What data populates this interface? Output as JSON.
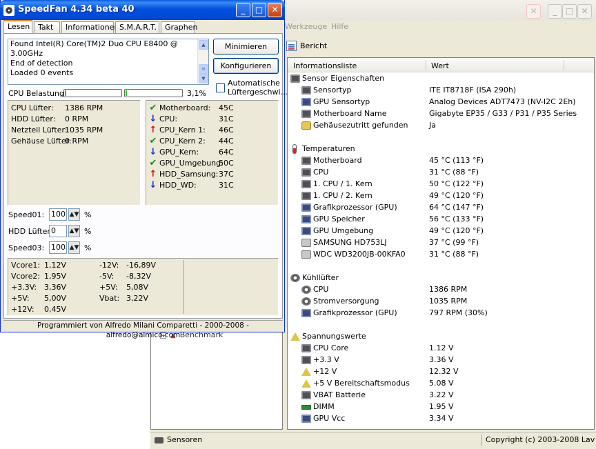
{
  "background_app": {
    "menu": [
      "Werkzeuge",
      "Hilfe"
    ],
    "toolbar_report": "Bericht",
    "left_tree_item": "Benchmark",
    "columns": {
      "name": "Informationsliste",
      "value": "Wert"
    },
    "groups": [
      {
        "title": "Sensor Eigenschaften",
        "icon": "chip-icon",
        "items": [
          {
            "label": "Sensortyp",
            "value": "ITE IT8718F (ISA 290h)",
            "icon": "chip-icon"
          },
          {
            "label": "GPU Sensortyp",
            "value": "Analog Devices ADT7473 (NV-I2C 2Eh)",
            "icon": "gpu-chip-icon"
          },
          {
            "label": "Motherboard Name",
            "value": "Gigabyte EP35 / G33 / P31 / P35 Series",
            "icon": "chip-icon"
          },
          {
            "label": "Gehäusezutritt gefunden",
            "value": "Ja",
            "icon": "lock-icon"
          }
        ]
      },
      {
        "title": "Temperaturen",
        "icon": "thermometer-icon",
        "items": [
          {
            "label": "Motherboard",
            "value": "45 °C  (113 °F)",
            "icon": "chip-icon"
          },
          {
            "label": "CPU",
            "value": "31 °C  (88 °F)",
            "icon": "chip-icon"
          },
          {
            "label": "1. CPU / 1. Kern",
            "value": "50 °C  (122 °F)",
            "icon": "chip-icon"
          },
          {
            "label": "1. CPU / 2. Kern",
            "value": "49 °C  (120 °F)",
            "icon": "chip-icon"
          },
          {
            "label": "Grafikprozessor (GPU)",
            "value": "64 °C  (147 °F)",
            "icon": "gpu-chip-icon"
          },
          {
            "label": "GPU Speicher",
            "value": "56 °C  (133 °F)",
            "icon": "gpu-chip-icon"
          },
          {
            "label": "GPU Umgebung",
            "value": "49 °C  (120 °F)",
            "icon": "gpu-chip-icon"
          },
          {
            "label": "SAMSUNG HD753LJ",
            "value": "37 °C  (99 °F)",
            "icon": "disk-icon"
          },
          {
            "label": "WDC WD3200JB-00KFA0",
            "value": "31 °C  (88 °F)",
            "icon": "disk-icon"
          }
        ]
      },
      {
        "title": "Kühllüfter",
        "icon": "fan-icon",
        "items": [
          {
            "label": "CPU",
            "value": "1386 RPM",
            "icon": "fan-icon"
          },
          {
            "label": "Stromversorgung",
            "value": "1035 RPM",
            "icon": "fan-icon"
          },
          {
            "label": "Grafikprozessor (GPU)",
            "value": "797 RPM  (30%)",
            "icon": "gpu-chip-icon"
          }
        ]
      },
      {
        "title": "Spannungswerte",
        "icon": "voltage-icon",
        "items": [
          {
            "label": "CPU Core",
            "value": "1.12 V",
            "icon": "chip-icon"
          },
          {
            "label": "+3.3 V",
            "value": "3.36 V",
            "icon": "chip-icon"
          },
          {
            "label": "+12 V",
            "value": "12.32 V",
            "icon": "voltage-icon"
          },
          {
            "label": "+5 V Bereitschaftsmodus",
            "value": "5.08 V",
            "icon": "voltage-icon"
          },
          {
            "label": "VBAT Batterie",
            "value": "3.22 V",
            "icon": "chip-icon"
          },
          {
            "label": "DIMM",
            "value": "1.95 V",
            "icon": "dimm-icon"
          },
          {
            "label": "GPU Vcc",
            "value": "3.34 V",
            "icon": "gpu-chip-icon"
          }
        ]
      }
    ],
    "status_left": "Sensoren",
    "status_right": "Copyright (c) 2003-2008 Lav"
  },
  "speedfan": {
    "title": "SpeedFan 4.34 beta 40",
    "tabs": [
      "Lesen",
      "Takt",
      "Informationen",
      "S.M.A.R.T.",
      "Graphen"
    ],
    "log": [
      "Found Intel(R) Core(TM)2 Duo CPU E8400 @ 3.00GHz",
      "End of detection",
      "Loaded 0 events"
    ],
    "buttons": {
      "minimize": "Minimieren",
      "configure": "Konfigurieren"
    },
    "auto_fan_label": "Automatische Lüftergeschwi...",
    "cpu_load_label": "CPU Belastung",
    "cpu_load_value": "3,1%",
    "cpu_core_usage": [
      0.03,
      0.02
    ],
    "fans": [
      {
        "label": "CPU Lüfter:",
        "value": "1386 RPM"
      },
      {
        "label": "HDD Lüfter:",
        "value": "0 RPM"
      },
      {
        "label": "Netzteil Lüfter:",
        "value": "1035 RPM"
      },
      {
        "label": "Gehäuse Lüfter:",
        "value": "0 RPM"
      }
    ],
    "temps": [
      {
        "label": "Motherboard:",
        "value": "45C",
        "state": "ok"
      },
      {
        "label": "CPU:",
        "value": "31C",
        "state": "down"
      },
      {
        "label": "CPU_Kern 1:",
        "value": "46C",
        "state": "up"
      },
      {
        "label": "CPU_Kern 2:",
        "value": "44C",
        "state": "ok"
      },
      {
        "label": "GPU_Kern:",
        "value": "64C",
        "state": "down"
      },
      {
        "label": "GPU_Umgebung:",
        "value": "50C",
        "state": "ok"
      },
      {
        "label": "HDD_Samsung:",
        "value": "37C",
        "state": "up"
      },
      {
        "label": "HDD_WD:",
        "value": "31C",
        "state": "down"
      }
    ],
    "speeds": [
      {
        "label": "Speed01:",
        "value": "100"
      },
      {
        "label": "HDD Lüfter:",
        "value": "0"
      },
      {
        "label": "Speed03:",
        "value": "100"
      }
    ],
    "percent_sign": "%",
    "voltages_left": [
      {
        "label": "Vcore1:",
        "value": "1,12V"
      },
      {
        "label": "Vcore2:",
        "value": "1,95V"
      },
      {
        "label": "+3.3V:",
        "value": "3,36V"
      },
      {
        "label": "+5V:",
        "value": "5,00V"
      },
      {
        "label": "+12V:",
        "value": "0,45V"
      }
    ],
    "voltages_right": [
      {
        "label": "-12V:",
        "value": "-16,89V"
      },
      {
        "label": "-5V:",
        "value": "-8,32V"
      },
      {
        "label": "+5V:",
        "value": "5,08V"
      },
      {
        "label": "Vbat:",
        "value": "3,22V"
      }
    ],
    "credit": "Programmiert von Alfredo Milani Comparetti - 2000-2008 - alfredo@almico.com"
  }
}
